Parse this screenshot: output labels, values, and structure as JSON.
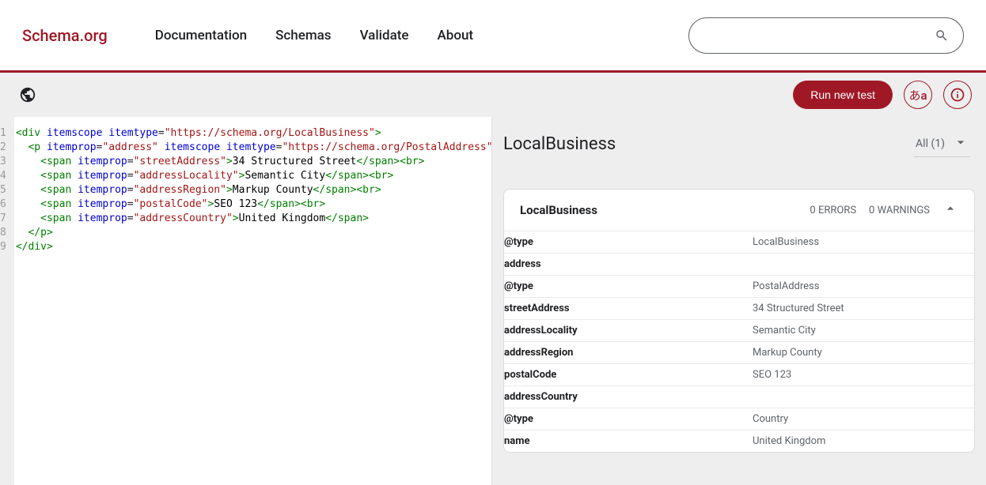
{
  "logo": "Schema.org",
  "nav": {
    "documentation": "Documentation",
    "schemas": "Schemas",
    "validate": "Validate",
    "about": "About"
  },
  "toolbar": {
    "run": "Run new test",
    "lang": "あa"
  },
  "code": {
    "lines": {
      "1": "1",
      "2": "2",
      "3": "3",
      "4": "4",
      "5": "5",
      "6": "6",
      "7": "7",
      "8": "8",
      "9": "9"
    },
    "l1_url": "\"https://schema.org/LocalBusiness\"",
    "l2_addr": "\"address\"",
    "l2_url": "\"https://schema.org/PostalAddress\"",
    "l3_prop": "\"streetAddress\"",
    "l3_txt": "34 Structured Street",
    "l4_prop": "\"addressLocality\"",
    "l4_txt": "Semantic City",
    "l5_prop": "\"addressRegion\"",
    "l5_txt": "Markup County",
    "l6_prop": "\"postalCode\"",
    "l6_txt": "SEO 123",
    "l7_prop": "\"addressCountry\"",
    "l7_txt": "United Kingdom"
  },
  "result": {
    "heading": "LocalBusiness",
    "filter": "All (1)",
    "card": {
      "title": "LocalBusiness",
      "errors": "0 ERRORS",
      "warnings": "0 WARNINGS",
      "rows": {
        "type_k": "@type",
        "type_v": "LocalBusiness",
        "address_k": "address",
        "sub_type_k": "@type",
        "sub_type_v": "PostalAddress",
        "street_k": "streetAddress",
        "street_v": "34 Structured Street",
        "loc_k": "addressLocality",
        "loc_v": "Semantic City",
        "reg_k": "addressRegion",
        "reg_v": "Markup County",
        "post_k": "postalCode",
        "post_v": "SEO 123",
        "country_k": "addressCountry",
        "country_type_k": "@type",
        "country_type_v": "Country",
        "name_k": "name",
        "name_v": "United Kingdom"
      }
    }
  }
}
